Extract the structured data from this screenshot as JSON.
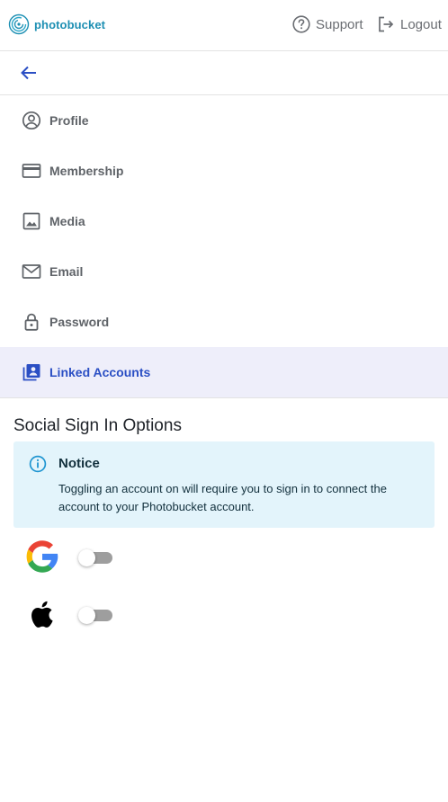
{
  "header": {
    "brand": "photobucket",
    "support_label": "Support",
    "logout_label": "Logout"
  },
  "nav": {
    "items": [
      {
        "label": "Profile",
        "icon": "profile-icon"
      },
      {
        "label": "Membership",
        "icon": "credit-card-icon"
      },
      {
        "label": "Media",
        "icon": "image-icon"
      },
      {
        "label": "Email",
        "icon": "mail-icon"
      },
      {
        "label": "Password",
        "icon": "lock-icon"
      },
      {
        "label": "Linked Accounts",
        "icon": "linked-accounts-icon",
        "active": true
      }
    ]
  },
  "main": {
    "title": "Social Sign In Options",
    "notice": {
      "title": "Notice",
      "text": "Toggling an account on will require you to sign in to connect the account to your Photobucket account."
    },
    "social": [
      {
        "provider": "google-icon",
        "enabled": false
      },
      {
        "provider": "apple-icon",
        "enabled": false
      }
    ]
  },
  "colors": {
    "accent": "#2b4fc4",
    "active_bg": "#eeeefa",
    "notice_bg": "#e3f4fb",
    "brand": "#1d8fb3"
  }
}
